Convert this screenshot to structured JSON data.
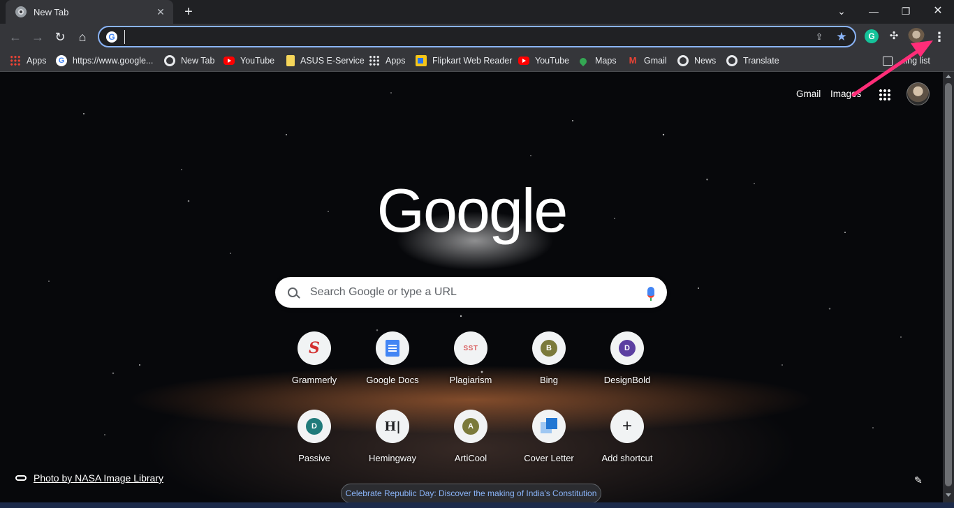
{
  "tab": {
    "title": "New Tab",
    "close_glyph": "✕"
  },
  "window": {
    "new_tab_glyph": "+",
    "tab_search_glyph": "⌄",
    "minimize_glyph": "—",
    "restore_glyph": "❐",
    "close_glyph": "✕"
  },
  "toolbar": {
    "back_glyph": "←",
    "forward_glyph": "→",
    "reload_glyph": "↻",
    "home_glyph": "⌂",
    "omnibox_value": "",
    "omnibox_g": "G",
    "share_glyph": "⇪",
    "star_glyph": "★",
    "grammarly_glyph": "G",
    "extensions_glyph": "✣",
    "menu_glyph": "⋮"
  },
  "bookmarks": [
    {
      "label": "Apps",
      "icon": "apps-grid-icon"
    },
    {
      "label": "https://www.google...",
      "icon": "google-icon"
    },
    {
      "label": "New Tab",
      "icon": "globe-icon"
    },
    {
      "label": "YouTube",
      "icon": "youtube-icon"
    },
    {
      "label": "ASUS E-Service",
      "icon": "bookmark-page-icon"
    },
    {
      "label": "Apps",
      "icon": "apps-grid-icon"
    },
    {
      "label": "Flipkart Web Reader",
      "icon": "flipkart-icon"
    },
    {
      "label": "YouTube",
      "icon": "youtube-icon"
    },
    {
      "label": "Maps",
      "icon": "maps-icon"
    },
    {
      "label": "Gmail",
      "icon": "gmail-icon"
    },
    {
      "label": "News",
      "icon": "globe-icon"
    },
    {
      "label": "Translate",
      "icon": "globe-icon"
    }
  ],
  "reading_list": {
    "label": "...ing list",
    "icon": "reading-list-icon"
  },
  "header": {
    "gmail": "Gmail",
    "images": "Images"
  },
  "logo_text": "Google",
  "search": {
    "placeholder": "Search Google or type a URL"
  },
  "shortcuts": [
    {
      "label": "Grammerly",
      "icon": "grammerly-icon",
      "glyph": "S"
    },
    {
      "label": "Google Docs",
      "icon": "google-docs-icon",
      "glyph": ""
    },
    {
      "label": "Plagiarism",
      "icon": "sst-icon",
      "glyph": "SST"
    },
    {
      "label": "Bing",
      "icon": "letter-b-icon",
      "glyph": "B",
      "color": "#7b7a3b"
    },
    {
      "label": "DesignBold",
      "icon": "letter-d-icon",
      "glyph": "D",
      "color": "#5b3fa1"
    },
    {
      "label": "Passive",
      "icon": "letter-d-icon",
      "glyph": "D",
      "color": "#1f7a7a"
    },
    {
      "label": "Hemingway",
      "icon": "hemingway-icon",
      "glyph": "H|"
    },
    {
      "label": "ArtiCool",
      "icon": "letter-a-icon",
      "glyph": "A",
      "color": "#7b7a3b"
    },
    {
      "label": "Cover Letter",
      "icon": "cover-letter-icon",
      "glyph": ""
    },
    {
      "label": "Add shortcut",
      "icon": "plus-icon",
      "glyph": "+"
    }
  ],
  "photo_credit": "Photo by NASA Image Library",
  "edit_glyph": "✎",
  "promo": "Celebrate Republic Day: Discover the making of India's Constitution",
  "colors": {
    "accent": "#8ab4f8",
    "toolbar": "#35363a",
    "annotation_arrow": "#ff2d78"
  }
}
